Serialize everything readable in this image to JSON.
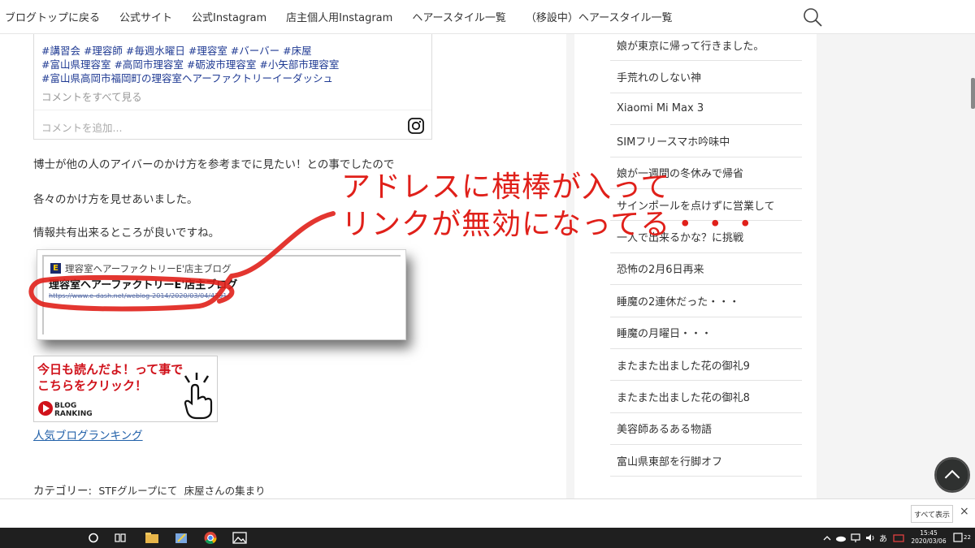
{
  "nav": {
    "items": [
      "ブログトップに戻る",
      "公式サイト",
      "公式Instagram",
      "店主個人用Instagram",
      "ヘアースタイル一覧",
      "（移設中）ヘアースタイル一覧"
    ]
  },
  "instagram_embed": {
    "hashtags": [
      "#講習会 #理容師 #毎週水曜日 #理容室 #バーバー #床屋",
      "#富山県理容室 #高岡市理容室 #砺波市理容室 #小矢部市理容室",
      "#富山県高岡市福岡町の理容室ヘアーファクトリーイーダッシュ"
    ],
    "view_comments": "コメントをすべて見る",
    "add_comment_placeholder": "コメントを追加..."
  },
  "article": {
    "paragraphs": [
      "博士が他の人のアイバーのかけ方を参考までに見たい！との事でしたので",
      "各々のかけ方を見せあいました。",
      "情報共有出来るところが良いですね。"
    ]
  },
  "link_card": {
    "site_name": "理容室ヘアーファクトリーE'店主ブログ",
    "title": "理容室ヘアーファクトリーE'店主ブログ",
    "url": "https://www.e-dash.net/weblog-2014/2020/03/04/4301/"
  },
  "banner": {
    "line1": "今日も読んだよ！って事で",
    "line2": "こちらをクリック！",
    "logo_text_top": "BLOG",
    "logo_text_bottom": "RANKING",
    "link_text": "人気ブログランキング"
  },
  "category": {
    "label": "カテゴリー:",
    "tags": [
      "STFグループにて",
      "床屋さんの集まり"
    ]
  },
  "sidebar": {
    "items": [
      "娘が東京に帰って行きました。",
      "手荒れのしない神",
      "Xiaomi Mi Max 3",
      "SIMフリースマホ吟味中",
      "娘が一週間の冬休みで帰省",
      "サインポールを点けずに営業して",
      "一人で出来るかな？に挑戦",
      "恐怖の2月6日再来",
      "睡魔の2連休だった・・・",
      "睡魔の月曜日・・・",
      "またまた出ました花の御礼9",
      "またまた出ました花の御礼8",
      "美容師あるある物語",
      "富山県東部を行脚オフ"
    ]
  },
  "annotation": {
    "line1": "アドレスに横棒が入って",
    "line2": "リンクが無効になってる・・・",
    "color": "#e0201a"
  },
  "download_bar": {
    "show_all": "すべて表示",
    "close": "×"
  },
  "taskbar": {
    "time": "15:45",
    "date": "2020/03/06",
    "ime": "あ",
    "notification_count": "22"
  },
  "colors": {
    "accent_red": "#e0201a",
    "link_blue": "#1f5fa8",
    "hashtag_blue": "#1f3a93"
  }
}
